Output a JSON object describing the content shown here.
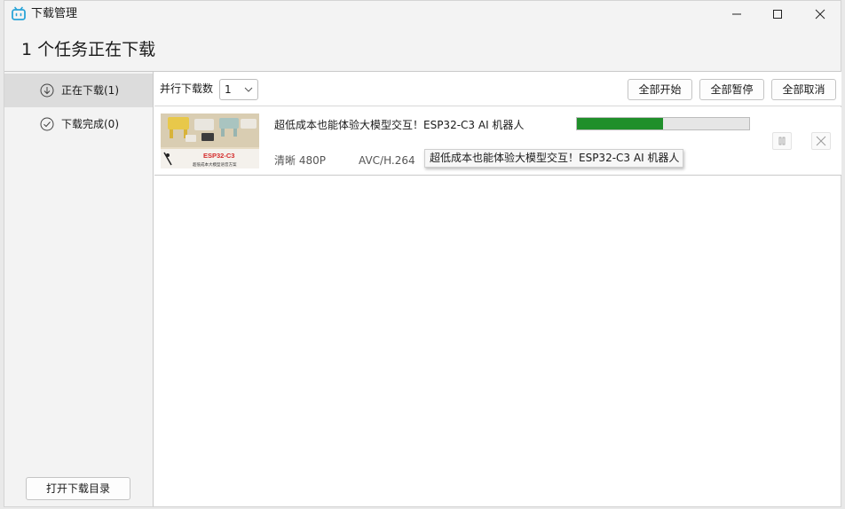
{
  "window": {
    "title": "下载管理"
  },
  "header": {
    "title": "1 个任务正在下载"
  },
  "sidebar": {
    "items": [
      {
        "label": "正在下载(1)",
        "icon": "download-circle-icon",
        "active": true
      },
      {
        "label": "下载完成(0)",
        "icon": "check-circle-icon",
        "active": false
      }
    ],
    "open_dir_label": "打开下载目录"
  },
  "toolbar": {
    "parallel_label": "并行下载数",
    "parallel_value": "1",
    "start_all": "全部开始",
    "pause_all": "全部暂停",
    "cancel_all": "全部取消"
  },
  "task": {
    "title": "超低成本也能体验大模型交互！ESP32-C3 AI 机器人",
    "quality": "清晰 480P",
    "codec": "AVC/H.264",
    "progress": 0.5,
    "thumb_caption": "ESP32-C3",
    "thumb_subcaption": "超低成本大模型语音方案"
  },
  "tooltip": {
    "text": "超低成本也能体验大模型交互！ESP32-C3 AI 机器人"
  },
  "colors": {
    "accent": "#1f8f2a",
    "brand_icon": "#2aa4d8"
  }
}
